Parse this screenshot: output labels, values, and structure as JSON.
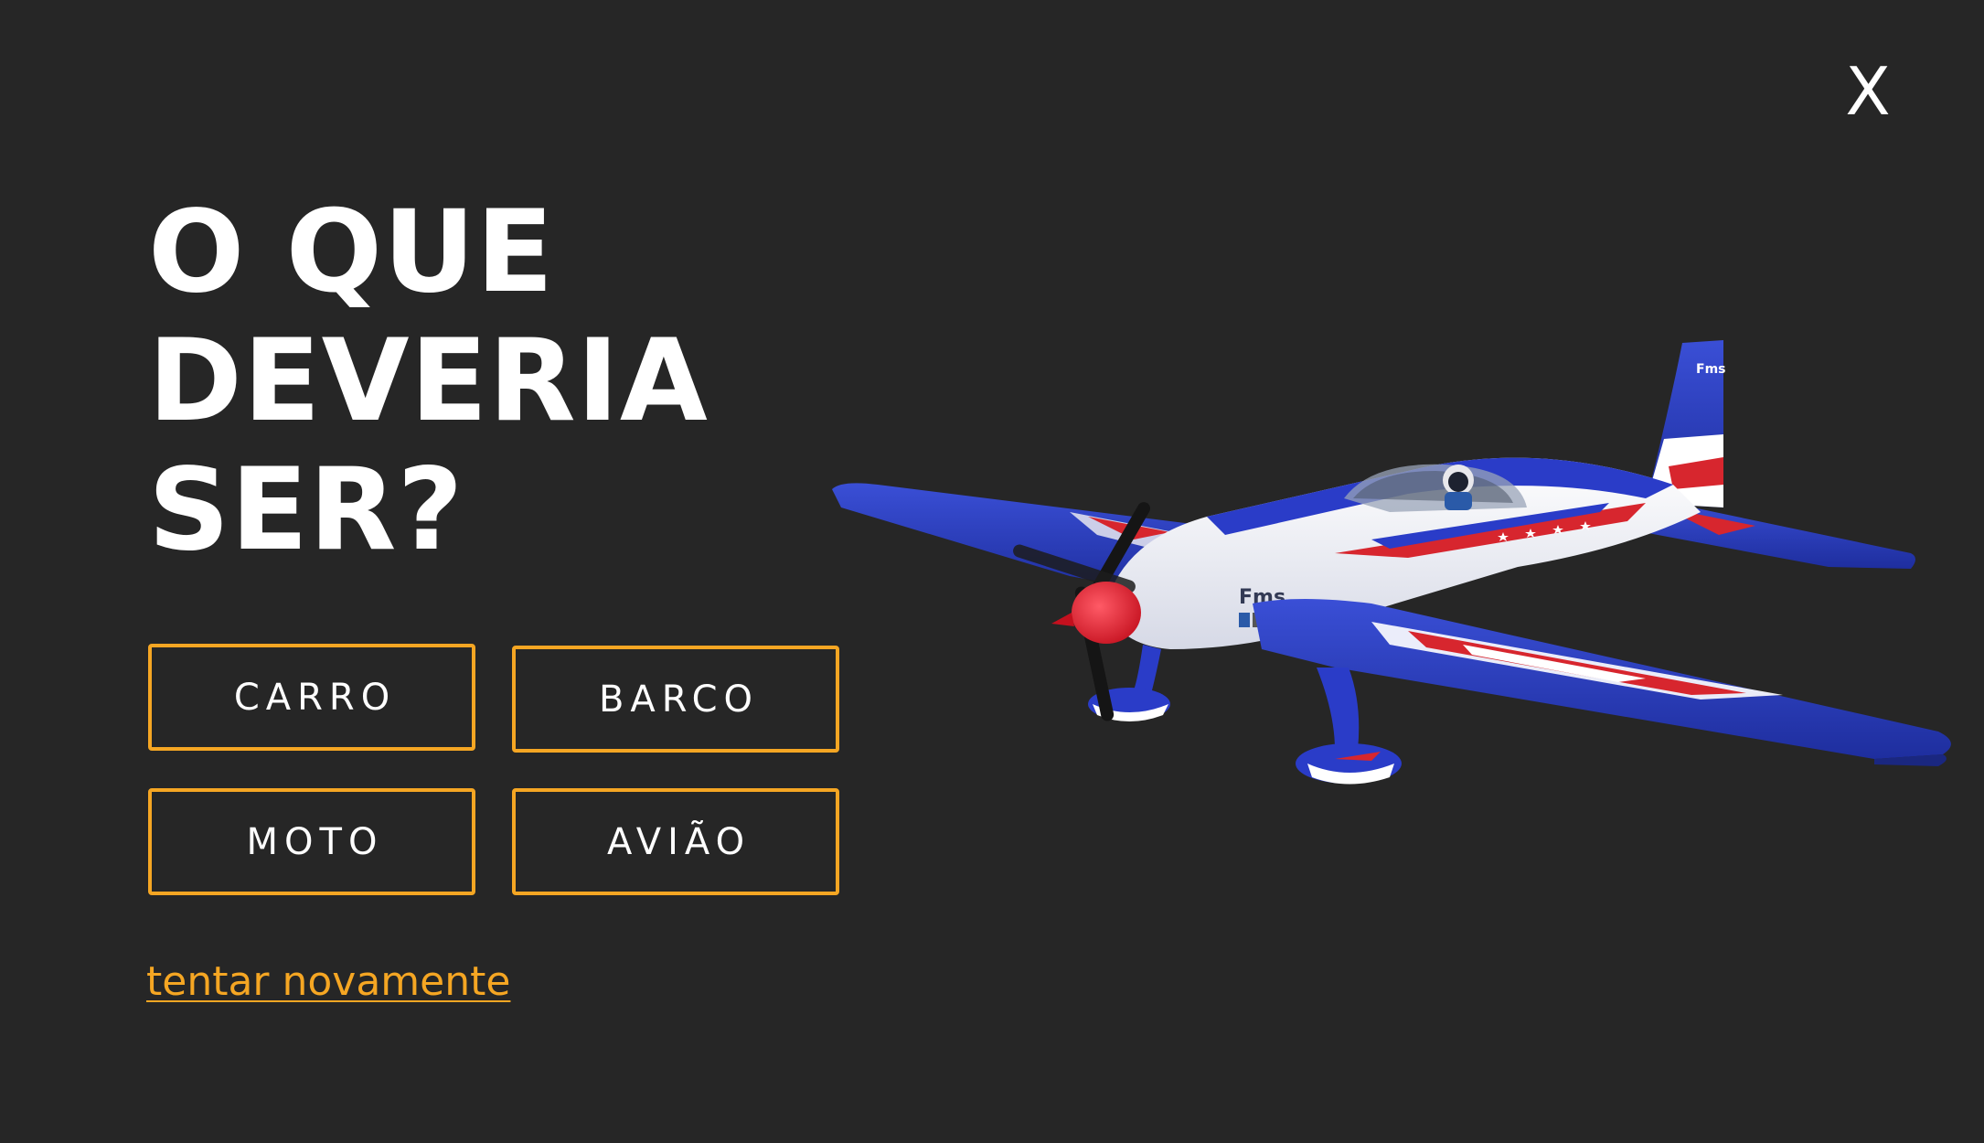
{
  "close": {
    "label": "X"
  },
  "question": {
    "line1": "O QUE",
    "line2": "DEVERIA",
    "line3": "SER?"
  },
  "options": [
    {
      "label": "CARRO"
    },
    {
      "label": "BARCO"
    },
    {
      "label": "MOTO"
    },
    {
      "label": "AVIÃO"
    }
  ],
  "retry": {
    "label": "tentar novamente"
  },
  "image": {
    "brand": "Fms",
    "subject": "airplane-image"
  },
  "colors": {
    "background": "#262626",
    "accent": "#f5a623",
    "text": "#ffffff"
  }
}
